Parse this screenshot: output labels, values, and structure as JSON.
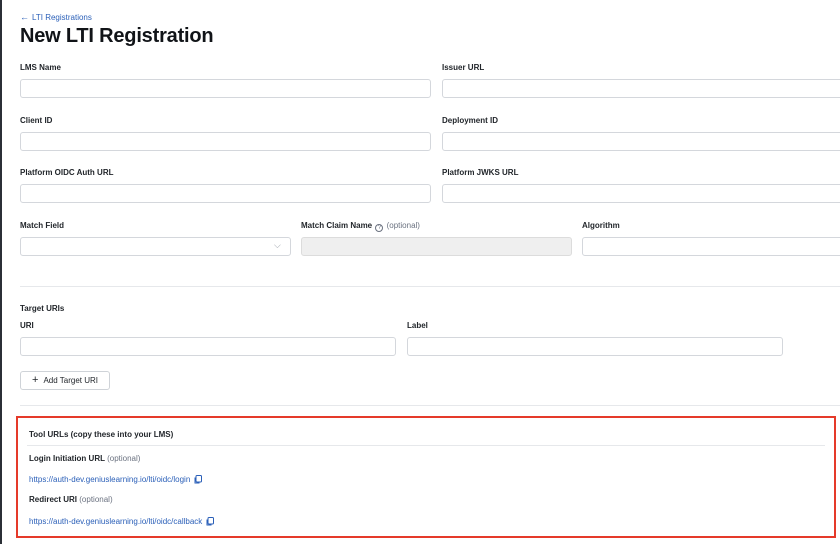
{
  "header": {
    "back_label": "LTI Registrations",
    "title": "New LTI Registration"
  },
  "form": {
    "lms_name_label": "LMS Name",
    "issuer_url_label": "Issuer URL",
    "client_id_label": "Client ID",
    "deployment_id_label": "Deployment ID",
    "oidc_auth_url_label": "Platform OIDC Auth URL",
    "jwks_url_label": "Platform JWKS URL",
    "match_field_label": "Match Field",
    "match_field_value": "",
    "match_claim_label": "Match Claim Name",
    "match_claim_optional": "(optional)",
    "algorithm_label": "Algorithm"
  },
  "target_uris": {
    "heading": "Target URIs",
    "uri_label": "URI",
    "label_label": "Label",
    "add_button": "Add Target URI"
  },
  "tool_urls": {
    "title": "Tool URLs (copy these into your LMS)",
    "login_label": "Login Initiation URL",
    "login_optional": "(optional)",
    "login_url": "https://auth-dev.geniuslearning.io/lti/oidc/login",
    "redirect_label": "Redirect URI",
    "redirect_optional": "(optional)",
    "redirect_url": "https://auth-dev.geniuslearning.io/lti/oidc/callback"
  },
  "colors": {
    "link": "#2a5fb8",
    "highlight_border": "#e53a2a"
  },
  "icons": {
    "back": "arrow-left-icon",
    "help": "help-circle-icon",
    "chevron": "chevron-down-icon",
    "add": "plus-icon",
    "copy": "copy-icon"
  }
}
